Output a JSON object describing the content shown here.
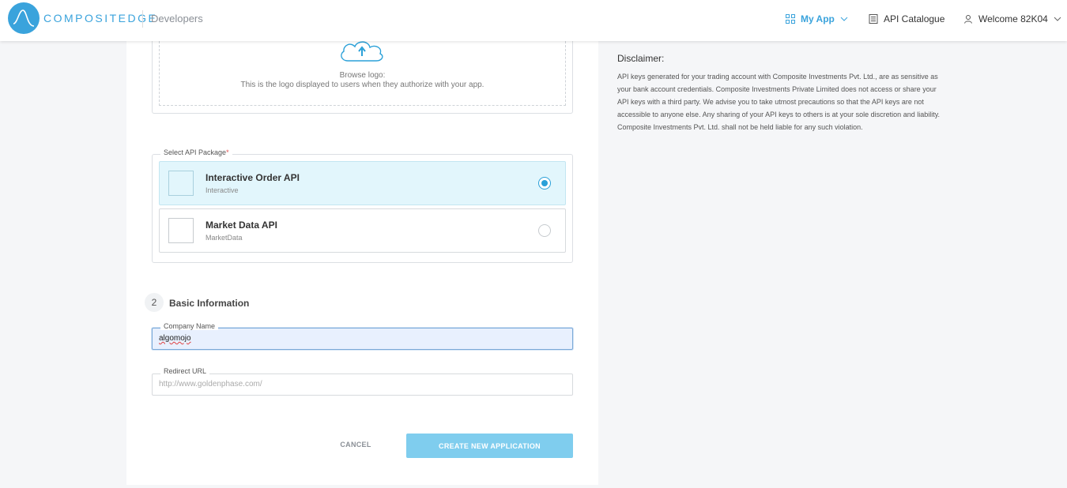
{
  "header": {
    "brand": "COMPOSITEDGE",
    "section": "Developers",
    "nav": {
      "my_app": "My App",
      "api_catalogue": "API Catalogue",
      "welcome": "Welcome 82K04"
    },
    "accent_color": "#3aa3dc"
  },
  "upload": {
    "browse_label": "Browse logo:",
    "browse_help": "This is the logo displayed to users when they authorize with your app."
  },
  "api_package": {
    "legend": "Select API Package",
    "required_mark": "*",
    "options": [
      {
        "title": "Interactive Order API",
        "subtitle": "Interactive",
        "selected": true
      },
      {
        "title": "Market Data API",
        "subtitle": "MarketData",
        "selected": false
      }
    ]
  },
  "basic_info": {
    "step": "2",
    "title": "Basic Information",
    "company_name": {
      "label": "Company Name",
      "value": "algomojo"
    },
    "redirect_url": {
      "label": "Redirect URL",
      "placeholder": "http://www.goldenphase.com/"
    }
  },
  "actions": {
    "cancel": "CANCEL",
    "create": "CREATE NEW APPLICATION"
  },
  "disclaimer": {
    "title": "Disclaimer:",
    "body": "API keys generated for your trading account with Composite Investments Pvt. Ltd., are as sensitive as your bank account credentials. Composite Investments Private Limited does not access or share your API keys with a third party. We advise you to take utmost precautions so that the API keys are not accessible to anyone else. Any sharing of your API keys to others is at your sole discretion and liability. Composite Investments Pvt. Ltd. shall not be held liable for any such violation."
  }
}
